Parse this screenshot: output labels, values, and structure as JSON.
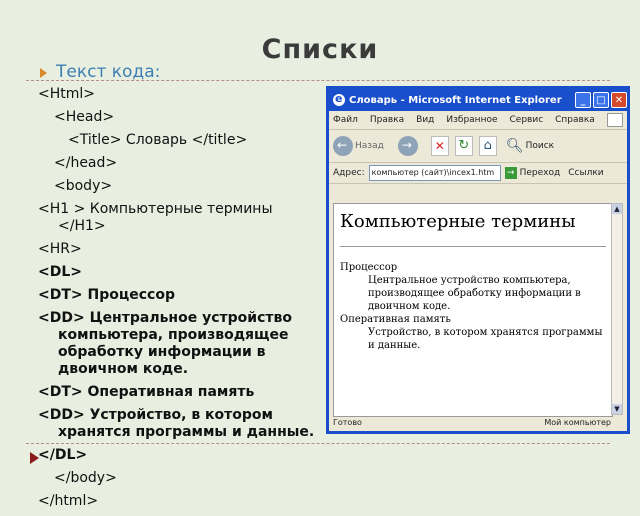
{
  "slide": {
    "title": "Списки",
    "bullet": "Текст кода:",
    "code_lines": [
      {
        "text": "<Html>",
        "bold": false,
        "indent": 0
      },
      {
        "text": "<Head>",
        "bold": false,
        "indent": 1
      },
      {
        "text": "<Title> Словарь </title>",
        "bold": false,
        "indent": 2
      },
      {
        "text": "</head>",
        "bold": false,
        "indent": 1
      },
      {
        "text": "<body>",
        "bold": false,
        "indent": 1
      },
      {
        "text": "<H1 > Компьютерные термины </H1>",
        "bold": false,
        "indent": 0
      },
      {
        "text": "<HR>",
        "bold": false,
        "indent": 0
      },
      {
        "text": "<DL>",
        "bold": true,
        "indent": 0
      },
      {
        "text": "<DT> Процессор",
        "bold": true,
        "indent": 0
      },
      {
        "text": "<DD> Центральное устройство компьютера, производящее обработку информации в двоичном коде.",
        "bold": true,
        "indent": 0
      },
      {
        "text": "<DT> Оперативная память",
        "bold": true,
        "indent": 0
      },
      {
        "text": "<DD> Устройство, в котором хранятся программы и данные.",
        "bold": true,
        "indent": 0
      },
      {
        "text": "</DL>",
        "bold": true,
        "indent": 0
      },
      {
        "text": "</body>",
        "bold": false,
        "indent": 1
      },
      {
        "text": "</html>",
        "bold": false,
        "indent": 0
      }
    ]
  },
  "browser": {
    "title": "Словарь - Microsoft Internet Explorer",
    "menu": [
      "Файл",
      "Правка",
      "Вид",
      "Избранное",
      "Сервис",
      "Справка"
    ],
    "back_label": "Назад",
    "search_label": "Поиск",
    "address_label": "Адрес:",
    "address_value": "компьютер (сайт)\\incex1.htm",
    "go_label": "Переход",
    "links_label": "Ссылки",
    "status_done": "Готово",
    "status_zone": "Мой компьютер",
    "page": {
      "heading": "Компьютерные термины",
      "terms": [
        {
          "dt": "Процессор",
          "dd": "Центральное устройство компьютера, производящее обработку информации в двоичном коде."
        },
        {
          "dt": "Оперативная память",
          "dd": "Устройство, в котором хранятся программы и данные."
        }
      ]
    }
  },
  "colors": {
    "background": "#e9efe0",
    "accent_bullet": "#d88a2c",
    "bullet_text": "#3c7fb1",
    "titlebar": "#1a4fcc"
  }
}
